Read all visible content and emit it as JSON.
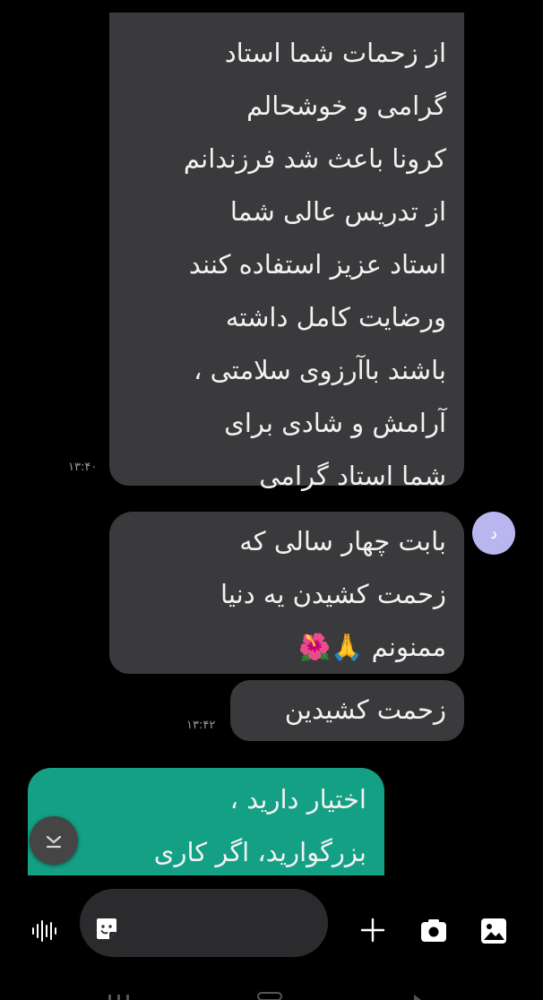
{
  "messages": [
    {
      "lines": [
        "از زحمات شما استاد",
        "گرامی و خوشحالم",
        "کرونا باعث شد فرزندانم",
        "از تدریس عالی شما",
        "استاد عزیز استفاده کنند",
        "ورضایت کامل داشته",
        "باشند باآرزوی سلامتی ،",
        "آرامش و شادی برای",
        "شما استاد گرامی"
      ],
      "time": "۱۳:۴۰"
    },
    {
      "lines": [
        "بابت چهار سالی که",
        "زحمت کشیدن یه دنیا",
        "ممنونم 🙏🌺"
      ]
    },
    {
      "lines": [
        "زحمت کشیدین"
      ],
      "time": "۱۳:۴۲"
    },
    {
      "lines": [
        "اختیار دارید ،",
        "بزرگوارید، اگر کاری"
      ]
    }
  ],
  "avatar": {
    "letter": "د",
    "color": "#b9b5ee"
  },
  "colors": {
    "incoming_bubble": "#3a3a3c",
    "outgoing_bubble": "#13a085",
    "background": "#000000"
  },
  "composer": {
    "icons": [
      "voice-icon",
      "sticker-icon",
      "add-icon",
      "camera-icon",
      "gallery-icon"
    ]
  }
}
